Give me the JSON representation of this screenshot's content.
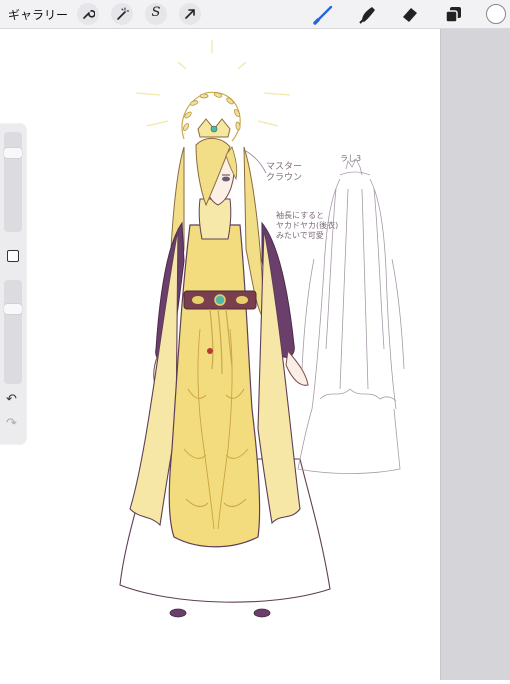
{
  "toolbar": {
    "gallery_label": "ギャラリー",
    "selection_glyph": "S"
  },
  "annotations": {
    "master_crown": [
      "マスター",
      "クラウン"
    ],
    "note": [
      "袖長にすると",
      "ヤカドヤカ(後衣)",
      "みたいで可愛"
    ],
    "sketch_label": "ラし3"
  },
  "colors": {
    "brush_active": "#2a66d9",
    "robe_purple": "#6b3f6c",
    "gold": "#f2dc8a",
    "outline": "#5e3f57"
  },
  "icons": {
    "wrench": "wrench-icon",
    "magic": "magic-wand-icon",
    "selection": "selection-icon",
    "transform": "transform-arrow-icon",
    "brush": "brush-icon",
    "smudge": "smudge-icon",
    "eraser": "eraser-icon",
    "layers": "layers-icon",
    "color": "color-circle-icon"
  }
}
